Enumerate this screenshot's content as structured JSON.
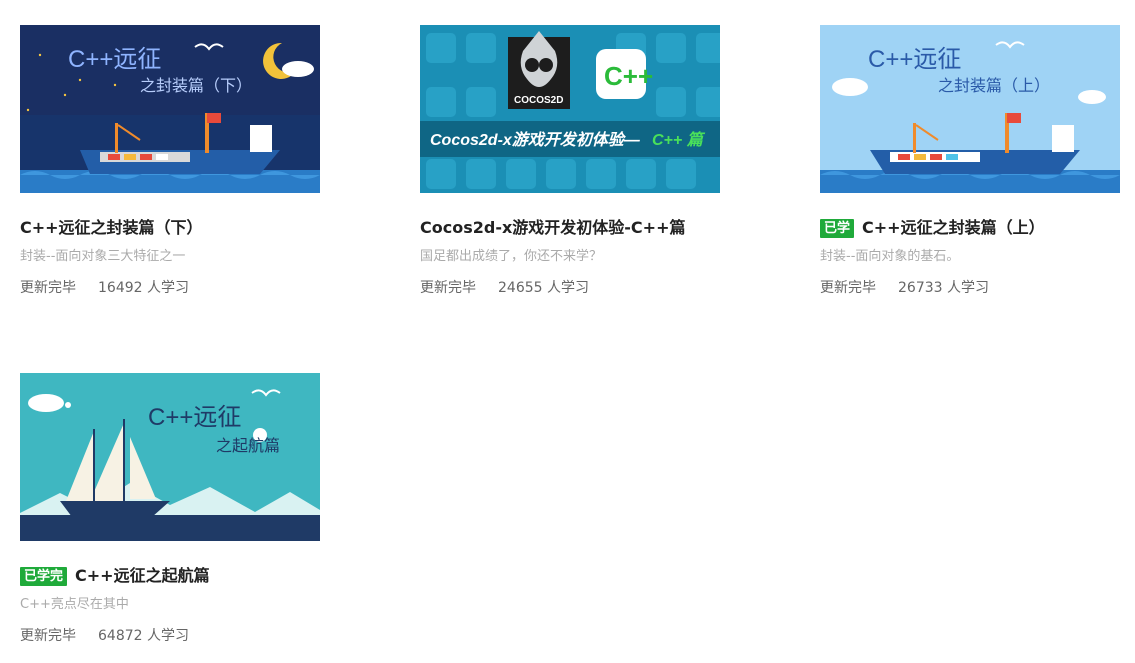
{
  "courses": [
    {
      "title": "C++远征之封装篇（下）",
      "badge": "",
      "desc": "封装--面向对象三大特征之一",
      "status": "更新完毕",
      "learners": "16492 人学习",
      "thumb": {
        "line1": "C++远征",
        "line2": "之封装篇（下）",
        "bg": "#17346b"
      }
    },
    {
      "title": "Cocos2d-x游戏开发初体验-C++篇",
      "badge": "",
      "desc": "国足都出成绩了，你还不来学？",
      "status": "更新完毕",
      "learners": "24655 人学习",
      "thumb": {
        "banner": "Cocos2d-x游戏开发初体验—",
        "banner_accent": "C++ 篇",
        "logo": "COCOS2D",
        "icon": "C++",
        "bg": "#1b8fb5"
      }
    },
    {
      "title": "C++远征之封装篇（上）",
      "badge": "已学",
      "desc": "封装--面向对象的基石。",
      "status": "更新完毕",
      "learners": "26733 人学习",
      "thumb": {
        "line1": "C++远征",
        "line2": "之封装篇（上）",
        "bg": "#9fd3f5"
      }
    },
    {
      "title": "C++远征之起航篇",
      "badge": "已学完",
      "desc": "C++亮点尽在其中",
      "status": "更新完毕",
      "learners": "64872 人学习",
      "thumb": {
        "line1": "C++远征",
        "line2": "之起航篇",
        "bg": "#3fb7c1"
      }
    }
  ]
}
